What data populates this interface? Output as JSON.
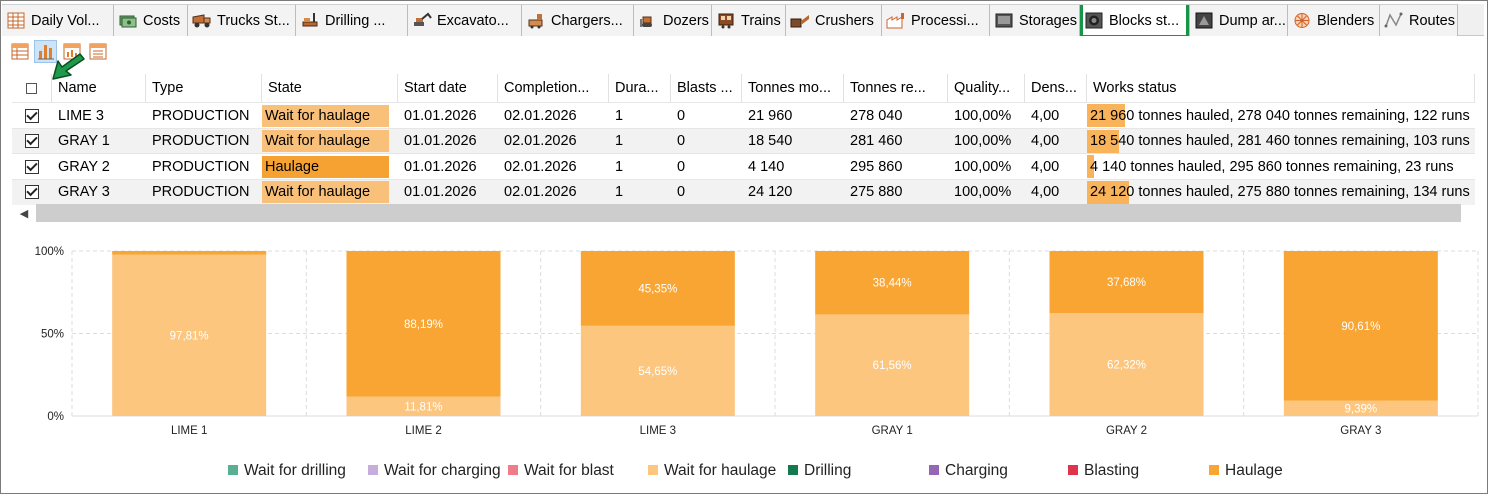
{
  "tabs": [
    {
      "label": "Daily Vol...",
      "icon": "calendar-grid-icon"
    },
    {
      "label": "Costs",
      "icon": "money-icon"
    },
    {
      "label": "Trucks St...",
      "icon": "truck-icon"
    },
    {
      "label": "Drilling ...",
      "icon": "drill-rig-icon"
    },
    {
      "label": "Excavato...",
      "icon": "excavator-icon"
    },
    {
      "label": "Chargers...",
      "icon": "charger-icon"
    },
    {
      "label": "Dozers",
      "icon": "dozer-icon"
    },
    {
      "label": "Trains",
      "icon": "train-icon"
    },
    {
      "label": "Crushers",
      "icon": "crusher-icon"
    },
    {
      "label": "Processi...",
      "icon": "factory-icon"
    },
    {
      "label": "Storages",
      "icon": "storage-icon"
    },
    {
      "label": "Blocks st...",
      "icon": "blocks-icon",
      "active": true
    },
    {
      "label": "Dump ar...",
      "icon": "dump-icon"
    },
    {
      "label": "Blenders",
      "icon": "blender-icon"
    },
    {
      "label": "Routes",
      "icon": "routes-icon"
    }
  ],
  "toolbar": [
    "table-view-icon",
    "bar-chart-view-icon",
    "chart-table-icon",
    "list-view-icon"
  ],
  "table": {
    "columns": [
      "Name",
      "Type",
      "State",
      "Start date",
      "Completion...",
      "Dura...",
      "Blasts ...",
      "Tonnes mo...",
      "Tonnes re...",
      "Quality...",
      "Dens...",
      "Works status"
    ],
    "rows": [
      {
        "checked": true,
        "name": "LIME 3",
        "type": "PRODUCTION",
        "state": "Wait for haulage",
        "start": "01.01.2026",
        "completion": "02.01.2026",
        "duration": "1",
        "blasts": "0",
        "moved": "21 960",
        "remaining": "278 040",
        "quality": "100,00%",
        "density": "4,00",
        "works": "21 960 tonnes hauled, 278 040 tonnes remaining, 122 runs",
        "progress": 0.0732
      },
      {
        "checked": true,
        "name": "GRAY 1",
        "type": "PRODUCTION",
        "state": "Wait for haulage",
        "start": "01.01.2026",
        "completion": "02.01.2026",
        "duration": "1",
        "blasts": "0",
        "moved": "18 540",
        "remaining": "281 460",
        "quality": "100,00%",
        "density": "4,00",
        "works": "18 540 tonnes hauled, 281 460 tonnes remaining, 103 runs",
        "progress": 0.0618
      },
      {
        "checked": true,
        "name": "GRAY 2",
        "type": "PRODUCTION",
        "state": "Haulage",
        "start": "01.01.2026",
        "completion": "02.01.2026",
        "duration": "1",
        "blasts": "0",
        "moved": "4 140",
        "remaining": "295 860",
        "quality": "100,00%",
        "density": "4,00",
        "works": "4 140 tonnes hauled, 295 860 tonnes remaining, 23 runs",
        "progress": 0.0138
      },
      {
        "checked": true,
        "name": "GRAY 3",
        "type": "PRODUCTION",
        "state": "Wait for haulage",
        "start": "01.01.2026",
        "completion": "02.01.2026",
        "duration": "1",
        "blasts": "0",
        "moved": "24 120",
        "remaining": "275 880",
        "quality": "100,00%",
        "density": "4,00",
        "works": "24 120 tonnes hauled, 275 880 tonnes remaining, 134 runs",
        "progress": 0.0804
      }
    ]
  },
  "state_colors": {
    "Wait for haulage": "#f9c07a",
    "Haulage": "#f5a232"
  },
  "chart_data": {
    "type": "bar",
    "stacked": true,
    "categories": [
      "LIME 1",
      "LIME 2",
      "LIME 3",
      "GRAY 1",
      "GRAY 2",
      "GRAY 3"
    ],
    "series": [
      {
        "name": "Wait for drilling",
        "color": "#56b091",
        "values": [
          0,
          0,
          0,
          0,
          0,
          0
        ]
      },
      {
        "name": "Wait for charging",
        "color": "#c7addb",
        "values": [
          0,
          0,
          0,
          0,
          0,
          0
        ]
      },
      {
        "name": "Wait for blast",
        "color": "#ef7c89",
        "values": [
          0,
          0,
          0,
          0,
          0,
          0
        ]
      },
      {
        "name": "Wait for haulage",
        "color": "#fcc67f",
        "values": [
          97.81,
          11.81,
          54.65,
          61.56,
          62.32,
          9.39
        ],
        "labels": [
          "97,81%",
          "11,81%",
          "54,65%",
          "61,56%",
          "62,32%",
          "9,39%"
        ]
      },
      {
        "name": "Drilling",
        "color": "#147a4e",
        "values": [
          0,
          0,
          0,
          0,
          0,
          0
        ]
      },
      {
        "name": "Charging",
        "color": "#9667b4",
        "values": [
          0,
          0,
          0,
          0,
          0,
          0
        ]
      },
      {
        "name": "Blasting",
        "color": "#e0344c",
        "values": [
          0,
          0,
          0,
          0,
          0,
          0
        ]
      },
      {
        "name": "Haulage",
        "color": "#f8a533",
        "values": [
          2.19,
          88.19,
          45.35,
          38.44,
          37.68,
          90.61
        ],
        "labels": [
          "",
          "88,19%",
          "45,35%",
          "38,44%",
          "37,68%",
          "90,61%"
        ]
      }
    ],
    "yticks": [
      "0%",
      "50%",
      "100%"
    ],
    "ylim": [
      0,
      100
    ],
    "grid": true,
    "legend": "bottom"
  }
}
